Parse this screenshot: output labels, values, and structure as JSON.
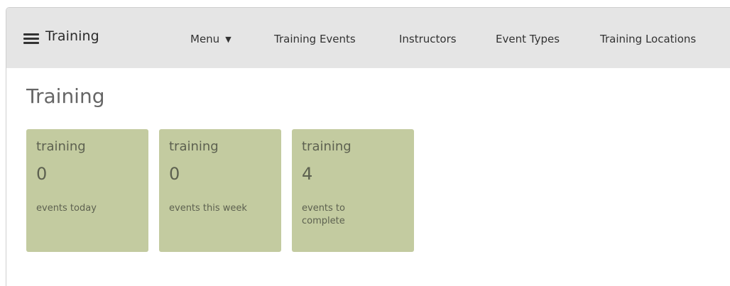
{
  "navbar": {
    "brand": "Training",
    "menu_label": "Menu",
    "menu_caret": "▼",
    "links": [
      "Training Events",
      "Instructors",
      "Event Types",
      "Training Locations"
    ]
  },
  "page": {
    "title": "Training"
  },
  "cards": [
    {
      "heading": "training",
      "count": "0",
      "caption": "events today"
    },
    {
      "heading": "training",
      "count": "0",
      "caption": "events this week"
    },
    {
      "heading": "training",
      "count": "4",
      "caption": "events to complete"
    }
  ],
  "colors": {
    "navbar_bg": "#e5e5e5",
    "card_bg": "#c3cba0"
  }
}
